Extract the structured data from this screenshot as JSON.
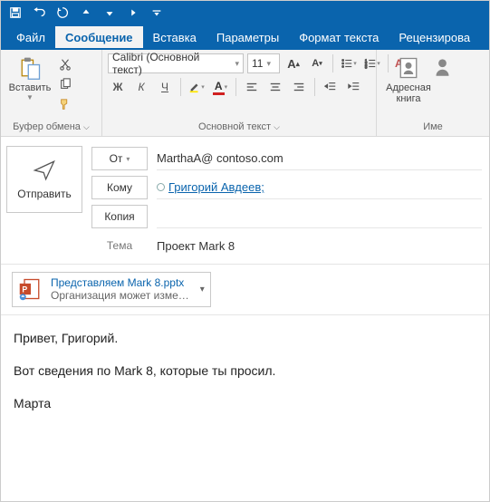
{
  "qat": {
    "items": [
      "save",
      "undo",
      "redo",
      "up",
      "down",
      "right",
      "grip"
    ]
  },
  "tabs": [
    {
      "id": "file",
      "label": "Файл"
    },
    {
      "id": "message",
      "label": "Сообщение",
      "active": true
    },
    {
      "id": "insert",
      "label": "Вставка"
    },
    {
      "id": "options",
      "label": "Параметры"
    },
    {
      "id": "format",
      "label": "Формат текста"
    },
    {
      "id": "review",
      "label": "Рецензирова"
    }
  ],
  "ribbon": {
    "clipboard": {
      "paste_label": "Вставить",
      "group_label": "Буфер обмена"
    },
    "basic_text": {
      "font_name": "Calibri (Основной текст)",
      "font_size": "11",
      "group_label": "Основной текст"
    },
    "names": {
      "address_book_label": "Адресная книга",
      "group_label": "Име"
    }
  },
  "compose": {
    "send_label": "Отправить",
    "from_label": "От",
    "from_value": "MarthaA@ contoso.com",
    "to_label": "Кому",
    "to_value": "Григорий Авдеев;",
    "cc_label": "Копия",
    "cc_value": "",
    "subject_label": "Тема",
    "subject_value": "Проект Mark 8"
  },
  "attachment": {
    "name": "Представляем Mark 8.pptx",
    "subtitle": "Организация может изме…"
  },
  "body": {
    "line1": "Привет, Григорий.",
    "line2": "Вот сведения по Mark 8, которые ты просил.",
    "signature": "Марта"
  }
}
